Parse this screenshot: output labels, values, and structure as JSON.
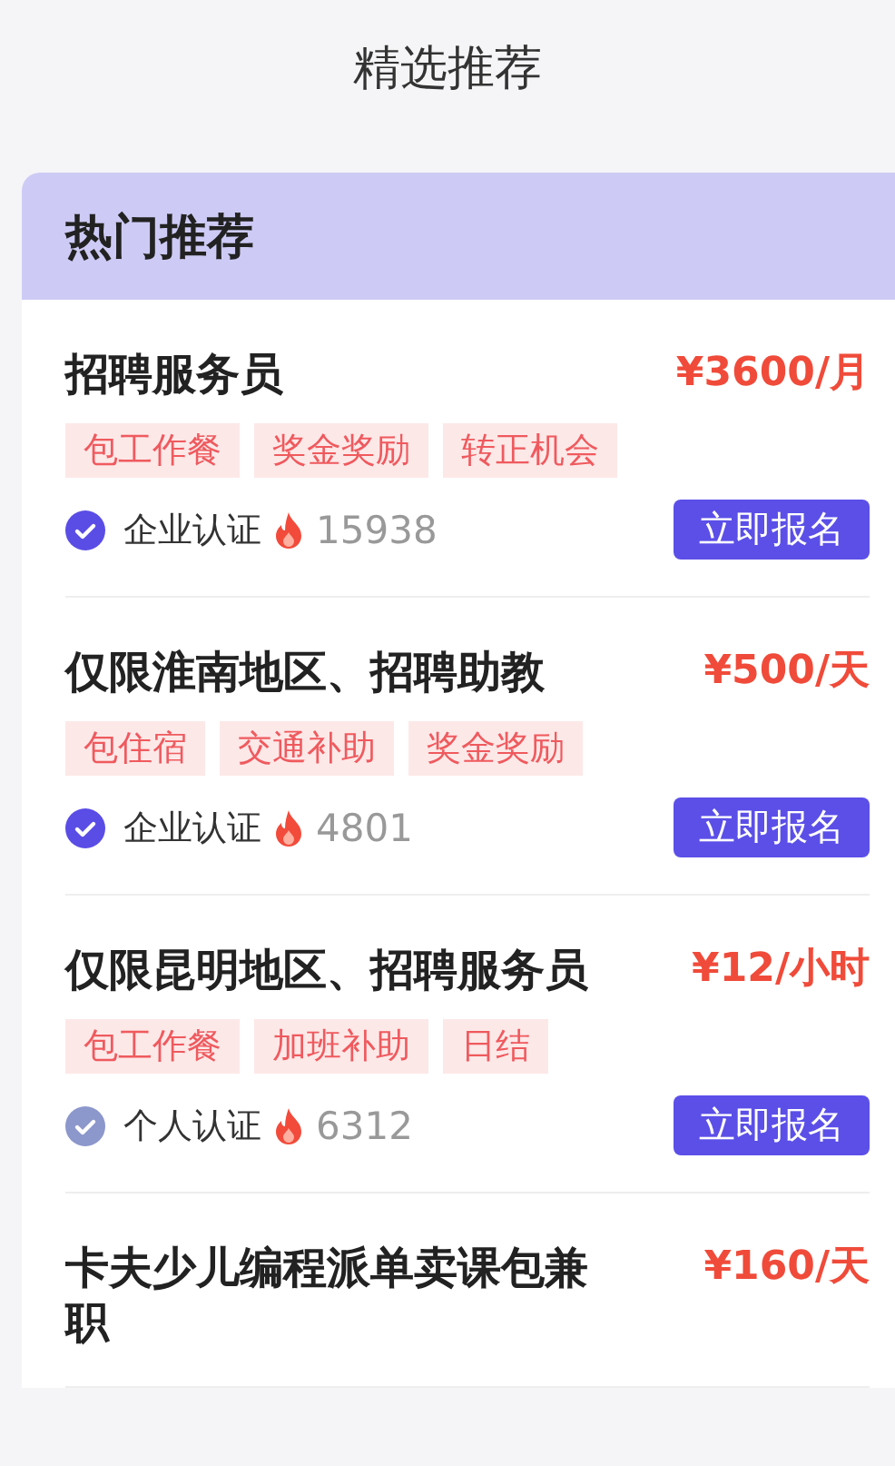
{
  "header": {
    "title": "精选推荐"
  },
  "section": {
    "title": "热门推荐"
  },
  "jobs": [
    {
      "title": "招聘服务员",
      "price": "¥3600/月",
      "tags": [
        "包工作餐",
        "奖金奖励",
        "转正机会"
      ],
      "verify": {
        "label": "企业认证",
        "color": "#5a4de6"
      },
      "views": "15938",
      "button": "立即报名"
    },
    {
      "title": "仅限淮南地区、招聘助教",
      "price": "¥500/天",
      "tags": [
        "包住宿",
        "交通补助",
        "奖金奖励"
      ],
      "verify": {
        "label": "企业认证",
        "color": "#5a4de6"
      },
      "views": "4801",
      "button": "立即报名"
    },
    {
      "title": "仅限昆明地区、招聘服务员",
      "price": "¥12/小时",
      "tags": [
        "包工作餐",
        "加班补助",
        "日结"
      ],
      "verify": {
        "label": "个人认证",
        "color": "#8c97cc"
      },
      "views": "6312",
      "button": "立即报名"
    },
    {
      "title": "卡夫少儿编程派单卖课包兼职",
      "price": "¥160/天"
    }
  ]
}
